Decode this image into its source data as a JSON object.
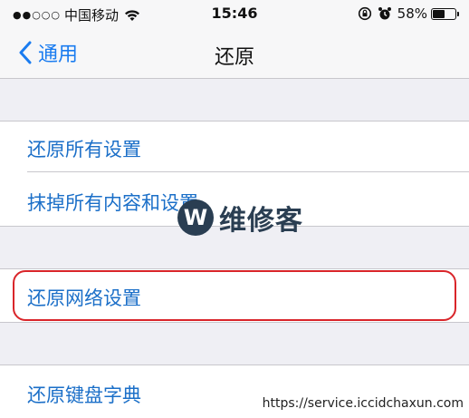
{
  "status_bar": {
    "signal": "●●○○○",
    "carrier": "中国移动",
    "time": "15:46",
    "battery": "58%",
    "battery_level": 0.58
  },
  "nav": {
    "back_label": "通用",
    "title": "还原"
  },
  "items": [
    {
      "label": "还原所有设置"
    },
    {
      "label": "抹掉所有内容和设置"
    },
    {
      "label": "还原网络设置"
    },
    {
      "label": "还原键盘字典"
    }
  ],
  "watermark": {
    "logo_letter": "W",
    "text": "维修客",
    "url": "https://service.iccidchaxun.com"
  },
  "colors": {
    "accent": "#1a7cf0",
    "item_text": "#1b6fc8",
    "highlight": "#d9252a",
    "background": "#efeff4"
  }
}
